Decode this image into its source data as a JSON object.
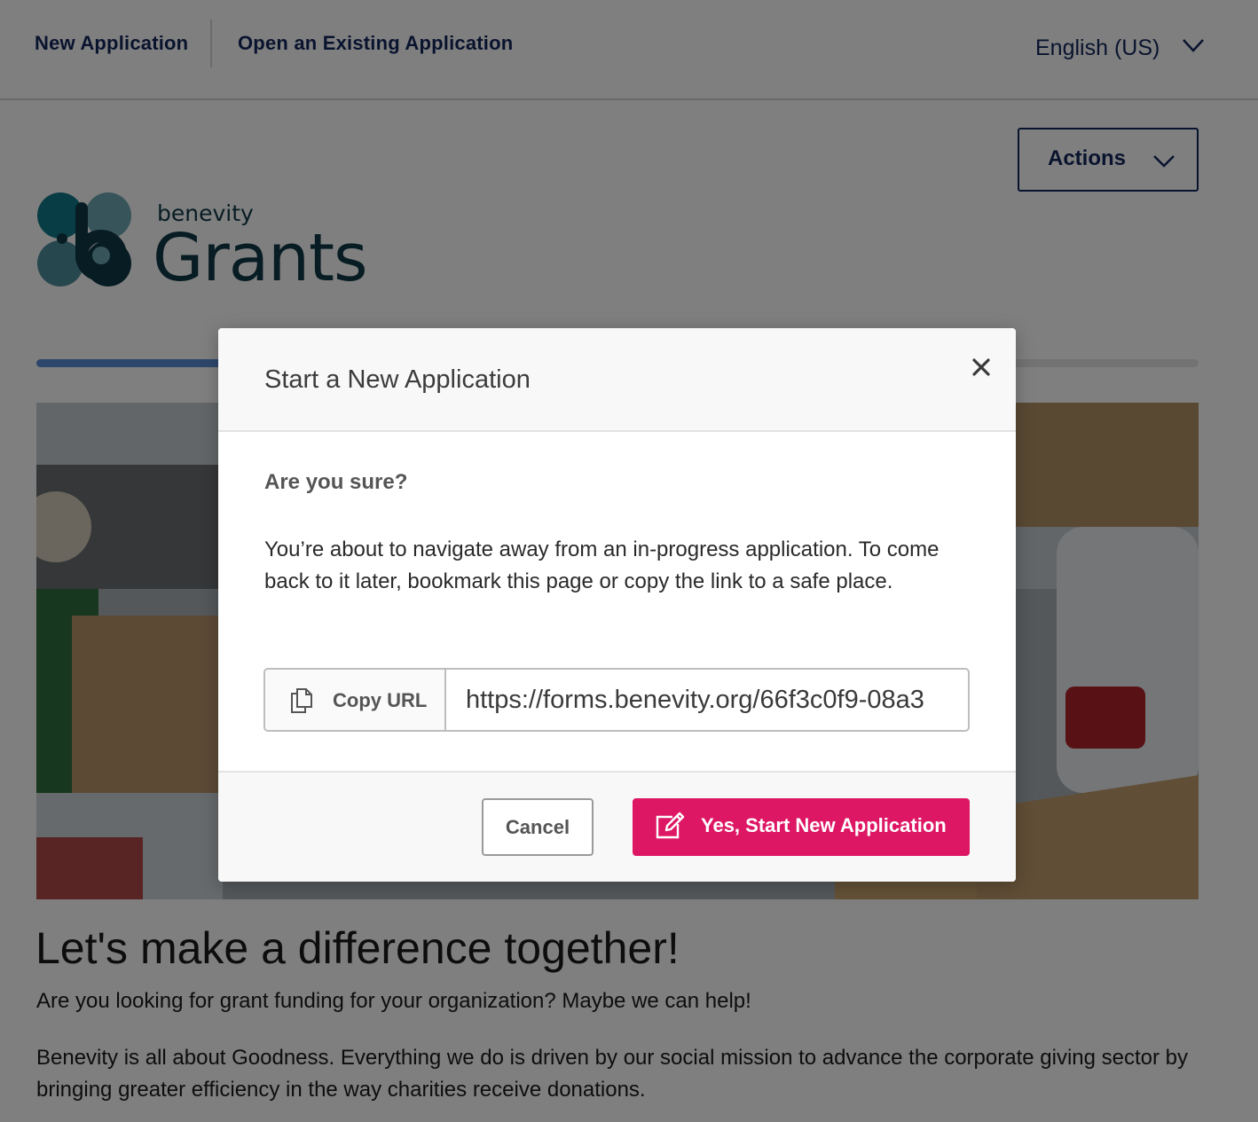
{
  "nav": {
    "new_application": "New Application",
    "open_existing": "Open an Existing Application",
    "language": "English (US)"
  },
  "actions": {
    "label": "Actions"
  },
  "logo": {
    "brand": "benevity",
    "product": "Grants"
  },
  "progress": {
    "fraction": 0.16
  },
  "content": {
    "headline": "Let's make a difference together!",
    "subheading": "Are you looking for grant funding for your organization? Maybe we can help!",
    "paragraph": "Benevity is all about Goodness. Everything we do is driven by our social mission to advance the corporate giving sector by bringing greater efficiency in the way charities receive donations."
  },
  "modal": {
    "title": "Start a New Application",
    "question": "Are you sure?",
    "description": "You’re about to navigate away from an in-progress application. To come back to it later, bookmark this page or copy the link to a safe place.",
    "copy_label": "Copy URL",
    "url_value": "https://forms.benevity.org/66f3c0f9-08a3",
    "cancel_label": "Cancel",
    "confirm_label": "Yes, Start New Application"
  },
  "colors": {
    "navy": "#13275c",
    "accent": "#de1765",
    "logo_teal": "#0e3847",
    "progress": "#5b8fd8"
  }
}
